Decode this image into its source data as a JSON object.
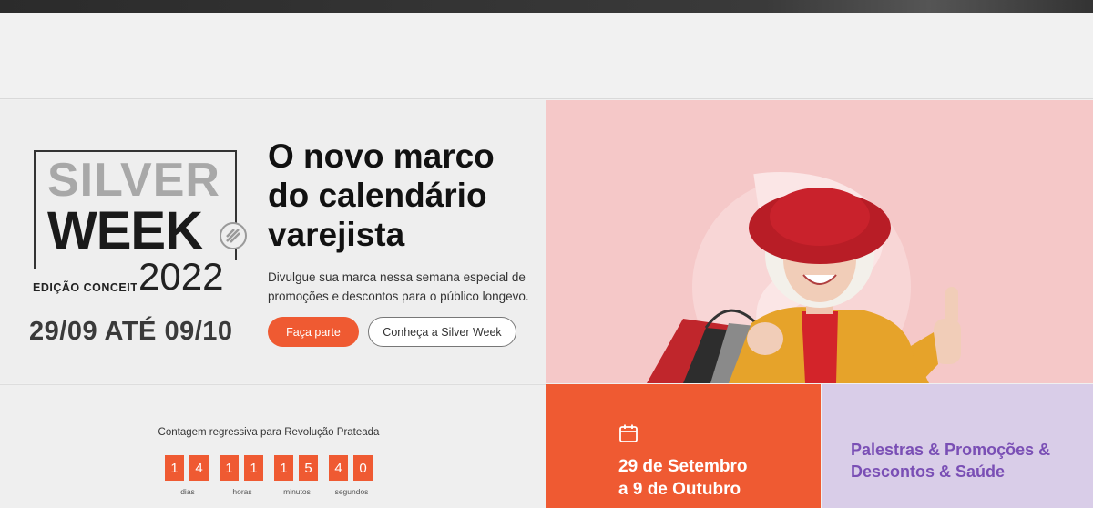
{
  "logo": {
    "line1": "SILVER",
    "line2": "WEEK",
    "edition": "EDIÇÃO CONCEITO",
    "year": "2022"
  },
  "hero": {
    "dates": "29/09 ATÉ 09/10",
    "headline": "O novo marco do calendário varejista",
    "description": "Divulgue sua marca nessa semana especial de promoções e descontos para o público longevo.",
    "primary_button": "Faça parte",
    "secondary_button": "Conheça a Silver Week",
    "image_alt": "Mulher idosa sorridente com chapéu vermelho segurando sacolas de compras"
  },
  "countdown": {
    "title": "Contagem regressiva para Revolução Prateada",
    "digits": {
      "days": [
        "1",
        "4"
      ],
      "hours": [
        "1",
        "1"
      ],
      "minutes": [
        "1",
        "5"
      ],
      "seconds": [
        "4",
        "0"
      ]
    },
    "labels": {
      "days": "dias",
      "hours": "horas",
      "minutes": "minutos",
      "seconds": "segundos"
    }
  },
  "event_dates": {
    "line1": "29 de Setembro",
    "line2": "a 9 de Outubro"
  },
  "topics": {
    "line1": "Palestras & Promoções &",
    "line2": "Descontos & Saúde"
  },
  "colors": {
    "accent_orange": "#ef5a32",
    "hero_pink": "#f5c8c8",
    "topics_lavender": "#d9cde8",
    "topics_purple": "#7a4fb5"
  }
}
